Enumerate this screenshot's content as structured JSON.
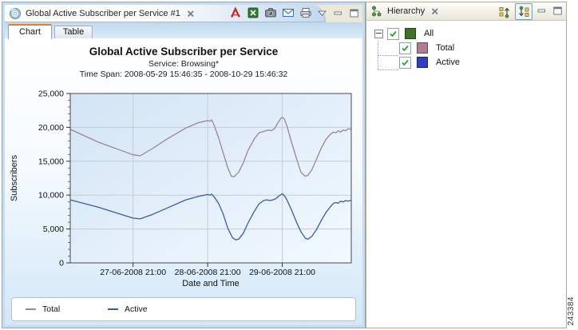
{
  "report_view": {
    "tab_title": "Global Active Subscriber per Service #1",
    "toolbar_icons": [
      "pdf-export-icon",
      "excel-export-icon",
      "snapshot-icon",
      "email-icon",
      "print-icon"
    ],
    "window_control_icons": [
      "view-menu-chevron-icon",
      "minimize-icon",
      "maximize-icon"
    ],
    "tabs": {
      "chart": "Chart",
      "table": "Table"
    }
  },
  "chart": {
    "title": "Global Active Subscriber per Service",
    "subtitle": "Service: Browsing*",
    "time_span": "Time Span: 2008-05-29 15:46:35 - 2008-10-29 15:46:32",
    "xlabel": "Date and Time",
    "ylabel": "Subscribers",
    "legend": [
      {
        "label": "Total",
        "color": "#9b8692"
      },
      {
        "label": "Active",
        "color": "#3b5ca8"
      }
    ]
  },
  "chart_data": {
    "type": "line",
    "title": "Global Active Subscriber per Service",
    "xlabel": "Date and Time",
    "ylabel": "Subscribers",
    "x_unit": "hours since 2008-06-27 00:00",
    "xlim": [
      0.8,
      91.2
    ],
    "ylim": [
      0,
      25000
    ],
    "y_ticks": [
      0,
      5000,
      10000,
      15000,
      20000,
      25000
    ],
    "y_minor_step": 1000,
    "x_ticks": [
      {
        "h": 21,
        "label": "27-06-2008 21:00"
      },
      {
        "h": 45,
        "label": "28-06-2008 21:00"
      },
      {
        "h": 69,
        "label": "29-06-2008 21:00"
      }
    ],
    "grid": true,
    "plot_colors": {
      "grid": "#c5cbd3",
      "border": "#494949",
      "bg_top": "#d3e4f5",
      "bg_bottom": "#f2f9ff"
    },
    "series": [
      {
        "name": "Total",
        "color": "#9b8692",
        "points": [
          [
            0.8,
            19700
          ],
          [
            10,
            17800
          ],
          [
            21,
            15950
          ],
          [
            23.3,
            15800
          ],
          [
            27,
            16800
          ],
          [
            32,
            18300
          ],
          [
            38,
            19900
          ],
          [
            42,
            20700
          ],
          [
            44,
            20900
          ],
          [
            45,
            21000
          ],
          [
            45.8,
            20900
          ],
          [
            46.3,
            21100
          ],
          [
            47,
            20400
          ],
          [
            48.5,
            18500
          ],
          [
            50,
            16200
          ],
          [
            51.5,
            14000
          ],
          [
            52.6,
            12800
          ],
          [
            53.5,
            12700
          ],
          [
            55,
            13400
          ],
          [
            56.5,
            14800
          ],
          [
            58,
            16600
          ],
          [
            60,
            18300
          ],
          [
            61.5,
            19200
          ],
          [
            63,
            19400
          ],
          [
            64.5,
            19600
          ],
          [
            65.5,
            19500
          ],
          [
            66.5,
            19800
          ],
          [
            67.5,
            20600
          ],
          [
            68.5,
            21300
          ],
          [
            69,
            21500
          ],
          [
            69.7,
            21200
          ],
          [
            70.5,
            20200
          ],
          [
            72,
            17800
          ],
          [
            73.5,
            15500
          ],
          [
            75,
            13400
          ],
          [
            76.3,
            12800
          ],
          [
            77.2,
            12900
          ],
          [
            78.5,
            13700
          ],
          [
            80,
            15300
          ],
          [
            81.5,
            16900
          ],
          [
            83,
            18200
          ],
          [
            84.5,
            19000
          ],
          [
            85.5,
            19300
          ],
          [
            86.3,
            19200
          ],
          [
            87,
            19500
          ],
          [
            87.8,
            19300
          ],
          [
            88.6,
            19600
          ],
          [
            89.4,
            19500
          ],
          [
            90.2,
            19800
          ],
          [
            91.2,
            19700
          ]
        ]
      },
      {
        "name": "Active",
        "color": "#3b5ca8",
        "points": [
          [
            0.8,
            9300
          ],
          [
            10,
            8200
          ],
          [
            21,
            6600
          ],
          [
            23.3,
            6500
          ],
          [
            27,
            7100
          ],
          [
            32,
            8100
          ],
          [
            38,
            9300
          ],
          [
            42,
            9800
          ],
          [
            44,
            10000
          ],
          [
            45,
            10100
          ],
          [
            45.8,
            10000
          ],
          [
            46.3,
            10150
          ],
          [
            47,
            9800
          ],
          [
            48.5,
            8800
          ],
          [
            50,
            7200
          ],
          [
            51.5,
            5100
          ],
          [
            53,
            3700
          ],
          [
            54,
            3400
          ],
          [
            55,
            3500
          ],
          [
            56.5,
            4400
          ],
          [
            58,
            5900
          ],
          [
            60,
            7600
          ],
          [
            61.5,
            8700
          ],
          [
            63,
            9200
          ],
          [
            64,
            9300
          ],
          [
            65,
            9200
          ],
          [
            66,
            9300
          ],
          [
            67,
            9500
          ],
          [
            68,
            9900
          ],
          [
            69,
            10200
          ],
          [
            69.7,
            9900
          ],
          [
            70.5,
            9300
          ],
          [
            72,
            7800
          ],
          [
            73.5,
            6100
          ],
          [
            75,
            4600
          ],
          [
            76.5,
            3600
          ],
          [
            77.3,
            3500
          ],
          [
            78.5,
            3900
          ],
          [
            80,
            4900
          ],
          [
            81.5,
            6200
          ],
          [
            83,
            7400
          ],
          [
            84.5,
            8300
          ],
          [
            85.5,
            8800
          ],
          [
            86.3,
            8900
          ],
          [
            87,
            8800
          ],
          [
            87.8,
            9100
          ],
          [
            88.6,
            9000
          ],
          [
            89.4,
            9200
          ],
          [
            90.2,
            9100
          ],
          [
            91.2,
            9250
          ]
        ]
      }
    ]
  },
  "hierarchy_view": {
    "tab_title": "Hierarchy",
    "toolbar_icons": [
      "tree-arrow-up-icon",
      "tree-arrow-down-icon"
    ],
    "window_control_icons": [
      "minimize-icon",
      "maximize-icon"
    ],
    "tree": {
      "root": {
        "label": "All",
        "color": "#3f7226",
        "checked": true,
        "expanded": true,
        "children": [
          {
            "label": "Total",
            "color": "#b27c8e",
            "checked": true
          },
          {
            "label": "Active",
            "color": "#2f3fbe",
            "checked": true
          }
        ]
      }
    }
  },
  "figure_number": "243384"
}
